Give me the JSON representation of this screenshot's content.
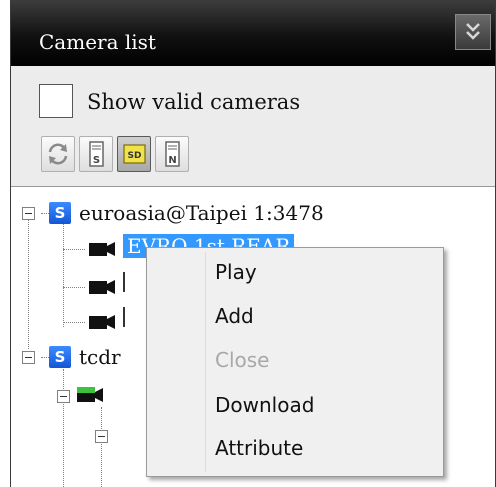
{
  "panel": {
    "title": "Camera list"
  },
  "filter": {
    "show_valid_label": "Show valid cameras",
    "checked": false
  },
  "toolbar": {
    "buttons": [
      "refresh-icon",
      "s-stream-icon",
      "sd-stream-icon",
      "n-stream-icon"
    ]
  },
  "tree": {
    "server1": {
      "badge": "S",
      "label": "euroasia@Taipei 1:3478",
      "selected_camera": "EVRO 1st REAR"
    },
    "server2": {
      "badge": "S",
      "label": "tcdr"
    }
  },
  "context_menu": {
    "items": [
      {
        "label": "Play",
        "enabled": true
      },
      {
        "label": "Add",
        "enabled": true
      },
      {
        "label": "Close",
        "enabled": false
      },
      {
        "label": "Download",
        "enabled": true
      },
      {
        "label": "Attribute",
        "enabled": true
      }
    ]
  }
}
